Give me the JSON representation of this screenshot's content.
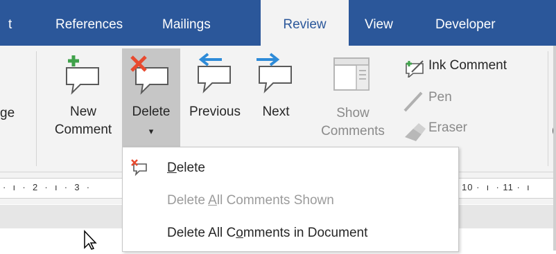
{
  "tabs": [
    {
      "label": "t",
      "active": false
    },
    {
      "label": "References",
      "active": false
    },
    {
      "label": "Mailings",
      "active": false
    },
    {
      "label": "Review",
      "active": true
    },
    {
      "label": "View",
      "active": false
    },
    {
      "label": "Developer",
      "active": false
    }
  ],
  "ribbon": {
    "partial_left_label": "ge",
    "new_comment": {
      "line1": "New",
      "line2": "Comment",
      "icon": "new-comment-icon"
    },
    "delete": {
      "line1": "Delete",
      "line2": "▾",
      "icon": "delete-comment-icon",
      "pressed": true
    },
    "previous": {
      "label": "Previous",
      "icon": "previous-comment-icon"
    },
    "next": {
      "label": "Next",
      "icon": "next-comment-icon"
    },
    "show_comments": {
      "line1": "Show",
      "line2": "Comments",
      "icon": "show-comments-icon",
      "disabled": true
    },
    "ink_comment": {
      "label": "Ink Comment",
      "icon": "ink-comment-icon"
    },
    "pen": {
      "label": "Pen",
      "icon": "pen-icon",
      "disabled": true
    },
    "eraser": {
      "label": "Eraser",
      "icon": "eraser-icon",
      "disabled": true
    },
    "partial_right_label": "("
  },
  "ruler": {
    "left_text": "·  ı  ·  2  ·  ı  ·  3  ·",
    "right_text": "10 ·  ı  · 11 ·  ı"
  },
  "delete_menu": {
    "items": [
      {
        "before": "",
        "mnemonic": "D",
        "after": "elete",
        "disabled": false,
        "icon": "delete-comment-icon"
      },
      {
        "before": "Delete ",
        "mnemonic": "A",
        "after": "ll Comments Shown",
        "disabled": true
      },
      {
        "before": "Delete All C",
        "mnemonic": "o",
        "after": "mments in Document",
        "disabled": false
      }
    ]
  },
  "colors": {
    "tab_bar": "#2b579a",
    "ribbon_bg": "#f3f3f3",
    "pressed_bg": "#c6c6c6",
    "delete_red": "#e84a2f",
    "arrow_blue": "#2e8bd8",
    "add_green": "#3fa14a"
  }
}
